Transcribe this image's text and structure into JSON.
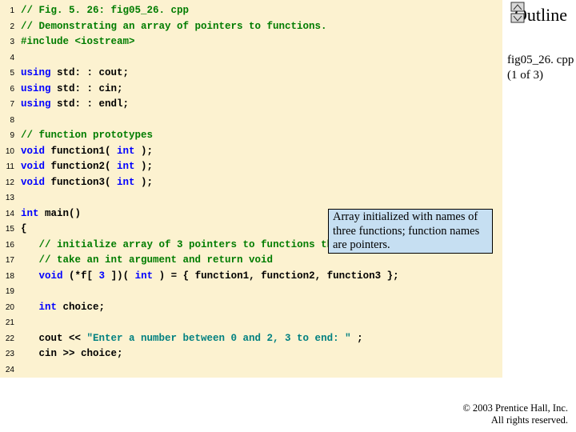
{
  "outline": {
    "title": "Outline",
    "file_name": "fig05_26. cpp",
    "file_part": "(1 of 3)"
  },
  "callout": {
    "text": "Array initialized with names of three functions; function names are pointers."
  },
  "copyright": {
    "line1": "© 2003 Prentice Hall, Inc.",
    "line2": "All rights reserved."
  },
  "code": {
    "lines": [
      {
        "n": "1",
        "seg": [
          {
            "c": "cm",
            "t": "// Fig. 5. 26: fig05_26. cpp"
          }
        ]
      },
      {
        "n": "2",
        "seg": [
          {
            "c": "cm",
            "t": "// Demonstrating an array of pointers to functions."
          }
        ]
      },
      {
        "n": "3",
        "seg": [
          {
            "c": "pp",
            "t": "#include "
          },
          {
            "c": "pp",
            "t": "<iostream>"
          }
        ]
      },
      {
        "n": "4",
        "seg": []
      },
      {
        "n": "5",
        "seg": [
          {
            "c": "kw",
            "t": "using "
          },
          {
            "c": "",
            "t": "std: : cout;"
          }
        ]
      },
      {
        "n": "6",
        "seg": [
          {
            "c": "kw",
            "t": "using "
          },
          {
            "c": "",
            "t": "std: : cin;"
          }
        ]
      },
      {
        "n": "7",
        "seg": [
          {
            "c": "kw",
            "t": "using "
          },
          {
            "c": "",
            "t": "std: : endl;"
          }
        ]
      },
      {
        "n": "8",
        "seg": []
      },
      {
        "n": "9",
        "seg": [
          {
            "c": "cm",
            "t": "// function prototypes"
          }
        ]
      },
      {
        "n": "10",
        "seg": [
          {
            "c": "kw",
            "t": "void "
          },
          {
            "c": "",
            "t": "function1( "
          },
          {
            "c": "kw",
            "t": "int"
          },
          {
            "c": "",
            "t": " );"
          }
        ]
      },
      {
        "n": "11",
        "seg": [
          {
            "c": "kw",
            "t": "void "
          },
          {
            "c": "",
            "t": "function2( "
          },
          {
            "c": "kw",
            "t": "int"
          },
          {
            "c": "",
            "t": " );"
          }
        ]
      },
      {
        "n": "12",
        "seg": [
          {
            "c": "kw",
            "t": "void "
          },
          {
            "c": "",
            "t": "function3( "
          },
          {
            "c": "kw",
            "t": "int"
          },
          {
            "c": "",
            "t": " );"
          }
        ]
      },
      {
        "n": "13",
        "seg": []
      },
      {
        "n": "14",
        "seg": [
          {
            "c": "kw",
            "t": "int "
          },
          {
            "c": "",
            "t": "main()"
          }
        ]
      },
      {
        "n": "15",
        "seg": [
          {
            "c": "",
            "t": "{"
          }
        ]
      },
      {
        "n": "16",
        "seg": [
          {
            "c": "",
            "t": "   "
          },
          {
            "c": "cm",
            "t": "// initialize array of 3 pointers to functions that each"
          }
        ]
      },
      {
        "n": "17",
        "seg": [
          {
            "c": "",
            "t": "   "
          },
          {
            "c": "cm",
            "t": "// take an int argument and return void"
          }
        ]
      },
      {
        "n": "18",
        "seg": [
          {
            "c": "",
            "t": "   "
          },
          {
            "c": "kw",
            "t": "void "
          },
          {
            "c": "",
            "t": "(*f[ "
          },
          {
            "c": "kw",
            "t": "3"
          },
          {
            "c": "",
            "t": " ])( "
          },
          {
            "c": "kw",
            "t": "int"
          },
          {
            "c": "",
            "t": " ) = { function1, function2, function3 };"
          }
        ]
      },
      {
        "n": "19",
        "seg": []
      },
      {
        "n": "20",
        "seg": [
          {
            "c": "",
            "t": "   "
          },
          {
            "c": "kw",
            "t": "int "
          },
          {
            "c": "",
            "t": "choice;"
          }
        ]
      },
      {
        "n": "21",
        "seg": []
      },
      {
        "n": "22",
        "seg": [
          {
            "c": "",
            "t": "   cout << "
          },
          {
            "c": "lit",
            "t": "\"Enter a number between 0 and 2, 3 to end: \""
          },
          {
            "c": "",
            "t": " ;"
          }
        ]
      },
      {
        "n": "23",
        "seg": [
          {
            "c": "",
            "t": "   cin >> choice;"
          }
        ]
      },
      {
        "n": "24",
        "seg": []
      }
    ]
  }
}
